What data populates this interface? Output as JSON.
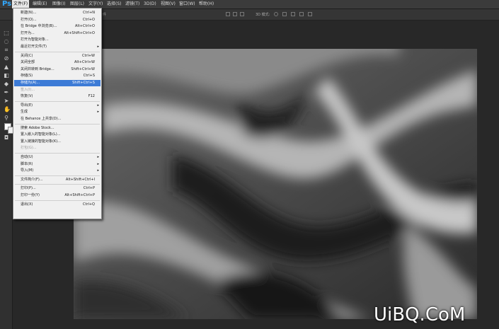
{
  "app": {
    "logo": "Ps"
  },
  "menubar": [
    {
      "label": "文件(F)",
      "active": true
    },
    {
      "label": "编辑(E)"
    },
    {
      "label": "图像(I)"
    },
    {
      "label": "图层(L)"
    },
    {
      "label": "文字(Y)"
    },
    {
      "label": "选择(S)"
    },
    {
      "label": "滤镜(T)"
    },
    {
      "label": "3D(D)"
    },
    {
      "label": "视图(V)"
    },
    {
      "label": "窗口(W)"
    },
    {
      "label": "帮助(H)"
    }
  ],
  "options_bar": {
    "mode_label": "3D 模式:",
    "fragment_label": "件"
  },
  "file_menu": [
    {
      "label": "新建(N)...",
      "shortcut": "Ctrl+N"
    },
    {
      "label": "打开(O)...",
      "shortcut": "Ctrl+O"
    },
    {
      "label": "在 Bridge 中浏览(B)...",
      "shortcut": "Alt+Ctrl+O"
    },
    {
      "label": "打开为...",
      "shortcut": "Alt+Shift+Ctrl+O"
    },
    {
      "label": "打开为智能对象..."
    },
    {
      "label": "最近打开文件(T)",
      "submenu": true
    },
    {
      "separator": true
    },
    {
      "label": "关闭(C)",
      "shortcut": "Ctrl+W"
    },
    {
      "label": "关闭全部",
      "shortcut": "Alt+Ctrl+W"
    },
    {
      "label": "关闭并转到 Bridge...",
      "shortcut": "Shift+Ctrl+W"
    },
    {
      "label": "存储(S)",
      "shortcut": "Ctrl+S"
    },
    {
      "label": "存储为(A)...",
      "shortcut": "Shift+Ctrl+S",
      "highlight": true
    },
    {
      "label": "签入(I)...",
      "disabled": true
    },
    {
      "label": "恢复(V)",
      "shortcut": "F12"
    },
    {
      "separator": true
    },
    {
      "label": "导出(E)",
      "submenu": true
    },
    {
      "label": "生成",
      "submenu": true
    },
    {
      "label": "在 Behance 上共享(D)..."
    },
    {
      "separator": true
    },
    {
      "label": "搜索 Adobe Stock..."
    },
    {
      "label": "置入嵌入的智能对象(L)..."
    },
    {
      "label": "置入链接的智能对象(K)..."
    },
    {
      "label": "打包(G)...",
      "disabled": true
    },
    {
      "separator": true
    },
    {
      "label": "自动(U)",
      "submenu": true
    },
    {
      "label": "脚本(R)",
      "submenu": true
    },
    {
      "label": "导入(M)",
      "submenu": true
    },
    {
      "separator": true
    },
    {
      "label": "文件简介(F)...",
      "shortcut": "Alt+Shift+Ctrl+I"
    },
    {
      "separator": true
    },
    {
      "label": "打印(P)...",
      "shortcut": "Ctrl+P"
    },
    {
      "label": "打印一份(Y)",
      "shortcut": "Alt+Shift+Ctrl+P"
    },
    {
      "separator": true
    },
    {
      "label": "退出(X)",
      "shortcut": "Ctrl+Q"
    }
  ],
  "watermark": "UiBQ.CoM",
  "colors": {
    "highlight": "#3d7bd6",
    "menu_bg": "#f0f0f0",
    "workspace": "#282828",
    "ps_blue": "#31a8ff"
  }
}
